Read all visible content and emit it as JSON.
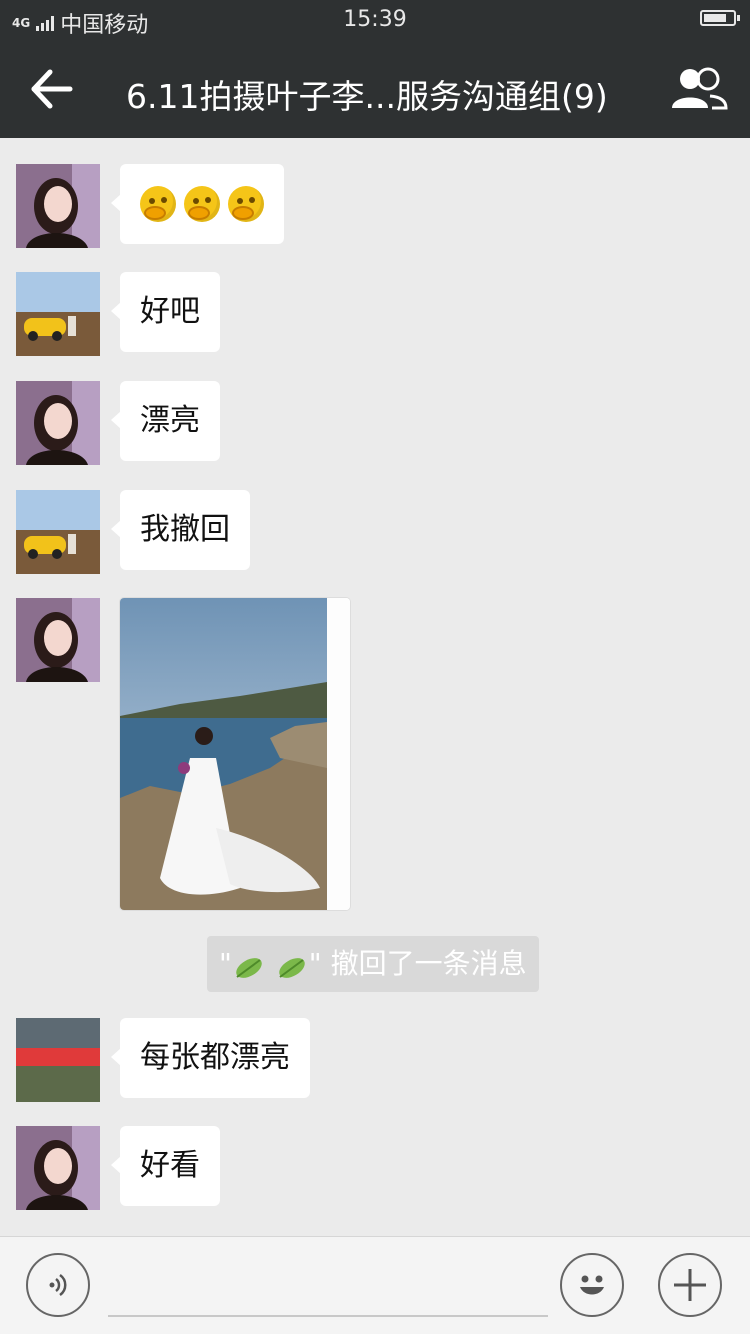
{
  "status_bar": {
    "network": "4G",
    "carrier": "中国移动",
    "time": "15:39"
  },
  "header": {
    "title": "6.11拍摄叶子李...服务沟通组(9)",
    "back_icon": "back-arrow-icon",
    "members_icon": "group-members-icon"
  },
  "messages": [
    {
      "sender_avatar": "woman-portrait",
      "type": "emoji",
      "content": [
        "thinking-face-emoji",
        "thinking-face-emoji",
        "thinking-face-emoji"
      ]
    },
    {
      "sender_avatar": "yellow-car",
      "type": "text",
      "text": "好吧"
    },
    {
      "sender_avatar": "woman-portrait",
      "type": "text",
      "text": "漂亮"
    },
    {
      "sender_avatar": "yellow-car",
      "type": "text",
      "text": "我撤回"
    },
    {
      "sender_avatar": "woman-portrait",
      "type": "image",
      "content": "wedding-dress-seaside-photo"
    },
    {
      "type": "system",
      "text": "撤回了一条消息"
    },
    {
      "sender_avatar": "street-sign",
      "type": "text",
      "text": "每张都漂亮"
    },
    {
      "sender_avatar": "woman-portrait",
      "type": "text",
      "text": "好看"
    }
  ],
  "input_bar": {
    "voice_icon": "voice-icon",
    "emoji_icon": "emoji-icon",
    "plus_icon": "plus-icon"
  },
  "colors": {
    "header_bg": "#2e3132",
    "chat_bg": "#ebebeb",
    "bubble_bg": "#ffffff",
    "system_note_bg": "#d9d9d9"
  }
}
